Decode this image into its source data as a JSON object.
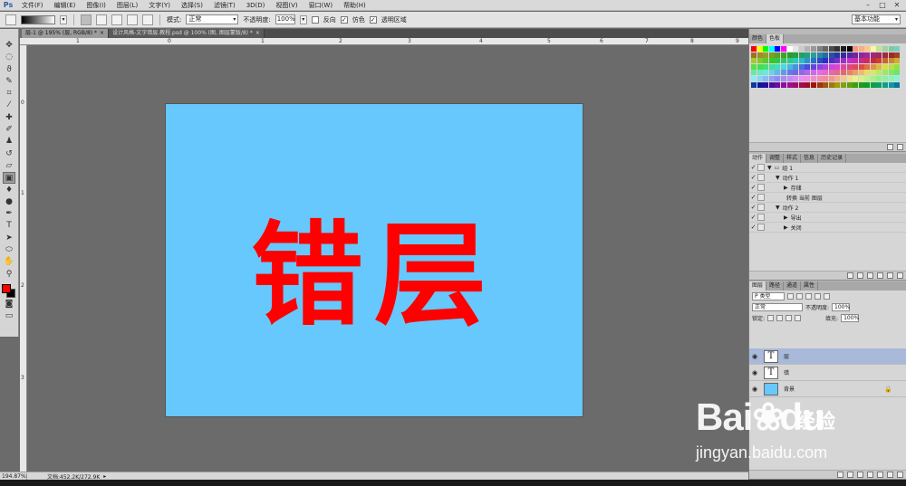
{
  "app": {
    "logo": "Ps"
  },
  "menu": [
    "文件(F)",
    "编辑(E)",
    "图像(I)",
    "图层(L)",
    "文字(Y)",
    "选择(S)",
    "滤镜(T)",
    "3D(D)",
    "视图(V)",
    "窗口(W)",
    "帮助(H)"
  ],
  "window_controls": [
    "–",
    "□",
    "✕"
  ],
  "options": {
    "mode_label": "模式:",
    "mode_value": "正常",
    "opacity_label": "不透明度:",
    "opacity_value": "100%",
    "reverse_label": "反向",
    "dither_label": "仿色",
    "transparency_label": "透明区域",
    "workspace": "基本功能"
  },
  "tabs": [
    {
      "label": "层-1 @ 195% (层, RGB/8) *"
    },
    {
      "label": "设计风格-文字错层.教程.psd @ 100% (图, 图层蒙版/8) *"
    }
  ],
  "rulers": {
    "h": [
      "1",
      "0",
      "1",
      "2",
      "3",
      "4",
      "5",
      "6",
      "7",
      "8",
      "9"
    ],
    "v": [
      "0",
      "1",
      "2",
      "3"
    ]
  },
  "canvas": {
    "background": "#66c8fd",
    "text": "错层",
    "text_color": "#ff0000"
  },
  "colors": {
    "foreground": "#ff0000",
    "background": "#000000"
  },
  "status": {
    "zoom": "194.87%",
    "doc": "文档:452.2K/272.9K"
  },
  "panels": {
    "swatches_tabs": [
      "颜色",
      "色板"
    ],
    "actions_tabs": [
      "动作",
      "调整",
      "样式",
      "信息",
      "历史记录"
    ],
    "actions": [
      {
        "indent": 0,
        "label": "组 1",
        "tri": "▼",
        "folder": true
      },
      {
        "indent": 1,
        "label": "动作 1",
        "tri": "▼"
      },
      {
        "indent": 2,
        "label": "存储",
        "tri": "▶"
      },
      {
        "indent": 2,
        "label": "转换 当前 图层",
        "tri": ""
      },
      {
        "indent": 1,
        "label": "动作 2",
        "tri": "▼"
      },
      {
        "indent": 2,
        "label": "导出",
        "tri": "▶"
      },
      {
        "indent": 2,
        "label": "关闭",
        "tri": "▶"
      }
    ],
    "layers_tabs": [
      "图层",
      "路径",
      "通道",
      "属性"
    ],
    "layers_filter": "P 类型",
    "blend_mode": "正常",
    "opacity_label": "不透明度:",
    "opacity_value": "100%",
    "lock_label": "锁定:",
    "fill_label": "填充:",
    "fill_value": "100%",
    "layers": [
      {
        "name": "层",
        "thumb": "T",
        "selected": true
      },
      {
        "name": "错",
        "thumb": "T",
        "selected": false
      },
      {
        "name": "背景",
        "thumb": "",
        "selected": false,
        "locked": true
      }
    ]
  },
  "watermark": {
    "brand": "Bai",
    "brand2": "du",
    "jingyan": "经验",
    "url": "jingyan.baidu.com"
  }
}
